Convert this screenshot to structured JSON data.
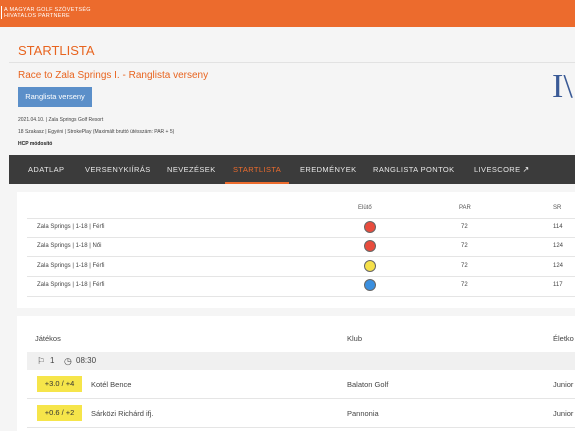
{
  "topbar": {
    "line1": "A MAGYAR GOLF SZÖVETSÉG",
    "line2": "HIVATALOS PARTNERE"
  },
  "page": {
    "heading": "STARTLISTA",
    "subtitle": "Race to Zala Springs I. - Ranglista verseny",
    "button": "Ranglista verseny",
    "info1": "2021.04.10. | Zala Springs Golf Resort",
    "info2": "18 Szakasz | Egyéni | StrokePlay (Maximált bruttó ütésszám: PAR + 5)",
    "info3": "HCP módosító",
    "logo": "I\\"
  },
  "nav": {
    "items": [
      "ADATLAP",
      "VERSENYKIÍRÁS",
      "NEVEZÉSEK",
      "STARTLISTA",
      "EREDMÉNYEK",
      "RANGLISTA PONTOK",
      "LIVESCORE"
    ],
    "active": "STARTLISTA"
  },
  "tees": {
    "headers": {
      "elotti": "Elütő",
      "par": "PAR",
      "sr": "SR"
    },
    "rows": [
      {
        "course": "Zala Springs | 1-18 | Férfi",
        "color": "#e84c3d",
        "par": "72",
        "sr": "114"
      },
      {
        "course": "Zala Springs | 1-18 | Női",
        "color": "#e84c3d",
        "par": "72",
        "sr": "124"
      },
      {
        "course": "Zala Springs | 1-18 | Férfi",
        "color": "#f5e04a",
        "par": "72",
        "sr": "124"
      },
      {
        "course": "Zala Springs | 1-18 | Férfi",
        "color": "#3a8fdf",
        "par": "72",
        "sr": "117"
      }
    ]
  },
  "players": {
    "headers": {
      "player": "Játékos",
      "club": "Klub",
      "age": "Életko"
    },
    "flight": {
      "number": "1",
      "time": "08:30"
    },
    "rows": [
      {
        "hcp": "+3.0 / +4",
        "name": "Kotél Bence",
        "club": "Balaton Golf",
        "age": "Junior"
      },
      {
        "hcp": "+0.6 / +2",
        "name": "Sárközi Richárd ifj.",
        "club": "Pannonia",
        "age": "Junior"
      }
    ]
  },
  "colors": {
    "orange": "#ec6b2d",
    "nav_bg": "#3b3b3b",
    "button_blue": "#5b8fc9",
    "badge_yellow": "#f6e54a"
  }
}
